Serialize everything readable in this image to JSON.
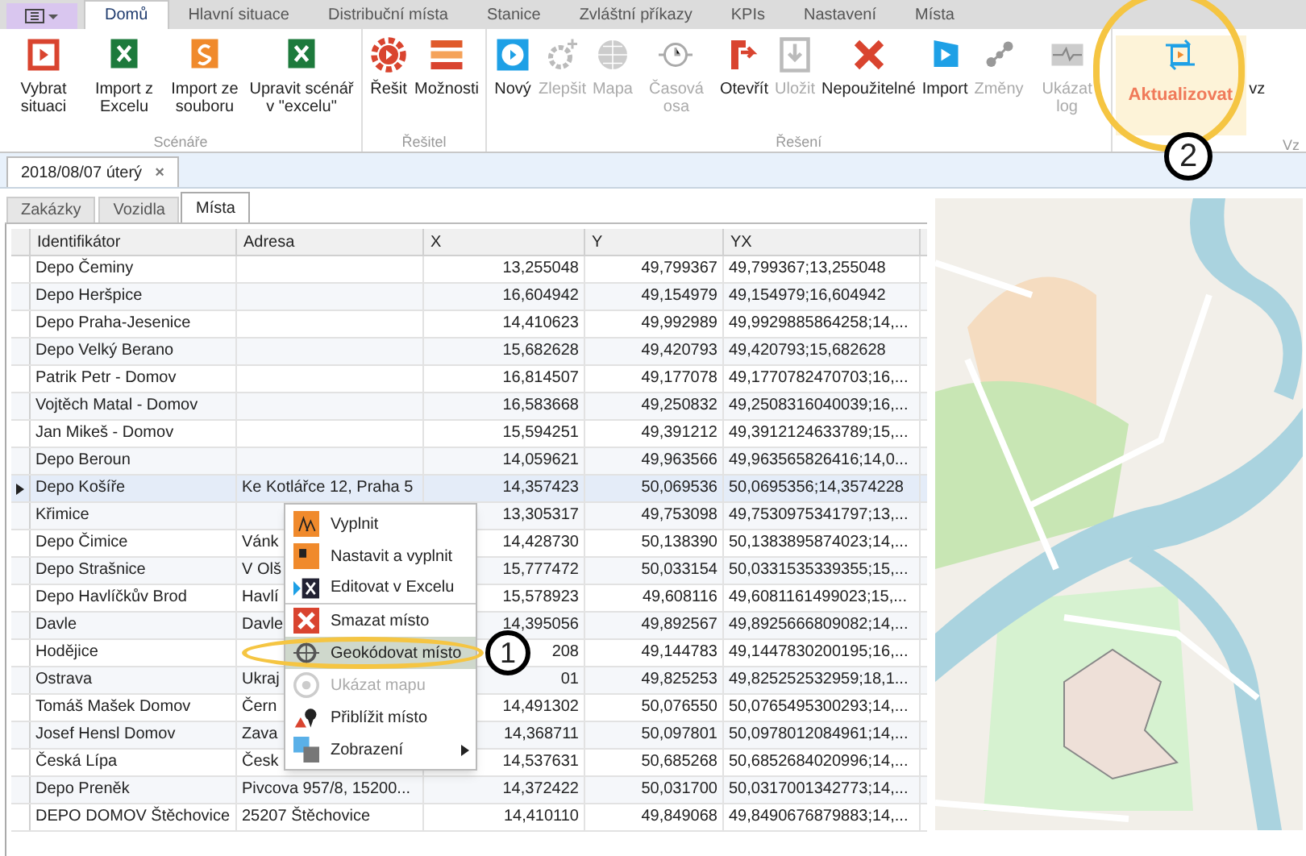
{
  "ribbon_tabs": [
    {
      "label": "Domů",
      "selected": true
    },
    {
      "label": "Hlavní situace",
      "selected": false
    },
    {
      "label": "Distribuční místa",
      "selected": false
    },
    {
      "label": "Stanice",
      "selected": false
    },
    {
      "label": "Zvláštní příkazy",
      "selected": false
    },
    {
      "label": "KPIs",
      "selected": false
    },
    {
      "label": "Nastavení",
      "selected": false
    },
    {
      "label": "Místa",
      "selected": false
    }
  ],
  "ribbon_groups": [
    {
      "label": "Scénáře",
      "buttons": [
        {
          "label": "Vybrat situaci",
          "disabled": false,
          "highlighted": false
        },
        {
          "label": "Import z Excelu",
          "disabled": false,
          "highlighted": false
        },
        {
          "label": "Import ze souboru",
          "disabled": false,
          "highlighted": false
        },
        {
          "label": "Upravit scénář v \"excelu\"",
          "disabled": false,
          "highlighted": false
        }
      ]
    },
    {
      "label": "Řešitel",
      "buttons": [
        {
          "label": "Řešit",
          "disabled": false,
          "highlighted": false
        },
        {
          "label": "Možnosti",
          "disabled": false,
          "highlighted": false
        }
      ]
    },
    {
      "label": "Řešení",
      "buttons": [
        {
          "label": "Nový",
          "disabled": false,
          "highlighted": false
        },
        {
          "label": "Zlepšit",
          "disabled": true,
          "highlighted": false
        },
        {
          "label": "Mapa",
          "disabled": true,
          "highlighted": false
        },
        {
          "label": "Časová osa",
          "disabled": true,
          "highlighted": false
        },
        {
          "label": "Otevřít",
          "disabled": false,
          "highlighted": false
        },
        {
          "label": "Uložit",
          "disabled": true,
          "highlighted": false
        },
        {
          "label": "Nepoužitelné",
          "disabled": false,
          "highlighted": false
        },
        {
          "label": "Import",
          "disabled": false,
          "highlighted": false
        },
        {
          "label": "Změny",
          "disabled": true,
          "highlighted": false
        },
        {
          "label": "Ukázat log",
          "disabled": true,
          "highlighted": false
        }
      ]
    },
    {
      "label": "Vz",
      "buttons": [
        {
          "label": "Aktualizovat",
          "disabled": false,
          "highlighted": true
        },
        {
          "label": "vz",
          "disabled": false,
          "highlighted": false
        }
      ]
    }
  ],
  "document_tab": {
    "label": "2018/08/07 úterý",
    "close": "×"
  },
  "view_tabs": [
    {
      "label": "Zakázky",
      "selected": false
    },
    {
      "label": "Vozidla",
      "selected": false
    },
    {
      "label": "Místa",
      "selected": true
    }
  ],
  "table": {
    "columns": [
      "Identifikátor",
      "Adresa",
      "X",
      "Y",
      "YX"
    ],
    "rows": [
      {
        "cells": [
          "Depo Čeminy",
          "",
          "13,255048",
          "49,799367",
          "49,799367;13,255048"
        ],
        "selected": false
      },
      {
        "cells": [
          "Depo Heršpice",
          "",
          "16,604942",
          "49,154979",
          "49,154979;16,604942"
        ],
        "selected": false
      },
      {
        "cells": [
          "Depo Praha-Jesenice",
          "",
          "14,410623",
          "49,992989",
          "49,9929885864258;14,..."
        ],
        "selected": false
      },
      {
        "cells": [
          "Depo Velký Berano",
          "",
          "15,682628",
          "49,420793",
          "49,420793;15,682628"
        ],
        "selected": false
      },
      {
        "cells": [
          "Patrik Petr - Domov",
          "",
          "16,814507",
          "49,177078",
          "49,1770782470703;16,..."
        ],
        "selected": false
      },
      {
        "cells": [
          "Vojtěch Matal - Domov",
          "",
          "16,583668",
          "49,250832",
          "49,2508316040039;16,..."
        ],
        "selected": false
      },
      {
        "cells": [
          "Jan Mikeš - Domov",
          "",
          "15,594251",
          "49,391212",
          "49,3912124633789;15,..."
        ],
        "selected": false
      },
      {
        "cells": [
          "Depo Beroun",
          "",
          "14,059621",
          "49,963566",
          "49,963565826416;14,0..."
        ],
        "selected": false
      },
      {
        "cells": [
          "Depo Košíře",
          "Ke Kotlářce 12, Praha 5",
          "14,357423",
          "50,069536",
          "50,0695356;14,3574228"
        ],
        "selected": true
      },
      {
        "cells": [
          "Křimice",
          "",
          "13,305317",
          "49,753098",
          "49,7530975341797;13,..."
        ],
        "selected": false
      },
      {
        "cells": [
          "Depo Čimice",
          "Vánk",
          "14,428730",
          "50,138390",
          "50,1383895874023;14,..."
        ],
        "selected": false
      },
      {
        "cells": [
          "Depo Strašnice",
          "V Olš",
          "15,777472",
          "50,033154",
          "50,0331535339355;15,..."
        ],
        "selected": false
      },
      {
        "cells": [
          "Depo Havlíčkův Brod",
          "Havlí",
          "15,578923",
          "49,608116",
          "49,6081161499023;15,..."
        ],
        "selected": false
      },
      {
        "cells": [
          "Davle",
          "Davle",
          "14,395056",
          "49,892567",
          "49,8925666809082;14,..."
        ],
        "selected": false
      },
      {
        "cells": [
          "Hodějice",
          "",
          "208",
          "49,144783",
          "49,1447830200195;16,..."
        ],
        "selected": false
      },
      {
        "cells": [
          "Ostrava",
          "Ukraj",
          "01",
          "49,825253",
          "49,825252532959;18,1..."
        ],
        "selected": false
      },
      {
        "cells": [
          "Tomáš Mašek Domov",
          "Čern",
          "14,491302",
          "50,076550",
          "50,0765495300293;14,..."
        ],
        "selected": false
      },
      {
        "cells": [
          "Josef Hensl Domov",
          "Zava",
          "14,368711",
          "50,097801",
          "50,0978012084961;14,..."
        ],
        "selected": false
      },
      {
        "cells": [
          "Česká Lípa",
          "Česk",
          "14,537631",
          "50,685268",
          "50,6852684020996;14,..."
        ],
        "selected": false
      },
      {
        "cells": [
          "Depo Preněk",
          "Pivcova 957/8, 15200...",
          "14,372422",
          "50,031700",
          "50,0317001342773;14,..."
        ],
        "selected": false
      },
      {
        "cells": [
          "DEPO DOMOV Štěchovice",
          "25207 Štěchovice",
          "14,410110",
          "49,849068",
          "49,8490676879883;14,..."
        ],
        "selected": false
      }
    ]
  },
  "context_menu": {
    "items": [
      {
        "label": "Vyplnit",
        "disabled": false,
        "selected": false,
        "submenu": false,
        "separator_after": false
      },
      {
        "label": "Nastavit a vyplnit",
        "disabled": false,
        "selected": false,
        "submenu": false,
        "separator_after": false
      },
      {
        "label": "Editovat v Excelu",
        "disabled": false,
        "selected": false,
        "submenu": false,
        "separator_after": true
      },
      {
        "label": "Smazat místo",
        "disabled": false,
        "selected": false,
        "submenu": false,
        "separator_after": false
      },
      {
        "label": "Geokódovat místo",
        "disabled": false,
        "selected": true,
        "submenu": false,
        "separator_after": false
      },
      {
        "label": "Ukázat mapu",
        "disabled": true,
        "selected": false,
        "submenu": false,
        "separator_after": false
      },
      {
        "label": "Přiblížit místo",
        "disabled": false,
        "selected": false,
        "submenu": false,
        "separator_after": false
      },
      {
        "label": "Zobrazení",
        "disabled": false,
        "selected": false,
        "submenu": true,
        "separator_after": false
      }
    ]
  },
  "callouts": [
    "1",
    "2"
  ]
}
